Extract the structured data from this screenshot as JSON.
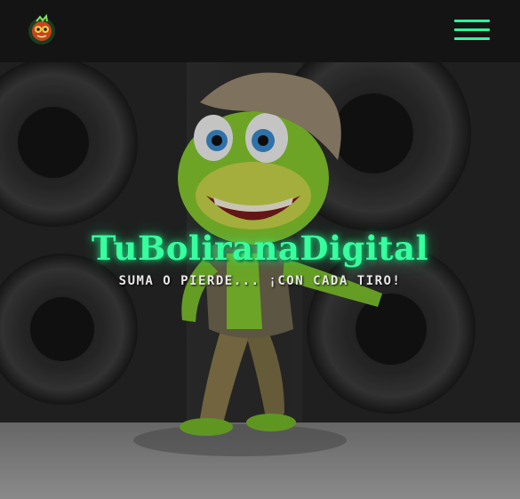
{
  "header": {
    "logo_icon": "frog-ball-logo-icon",
    "menu_icon": "hamburger-menu-icon",
    "accent_color": "#2dff9a"
  },
  "hero": {
    "title": "TuBoliranaDigital",
    "subtitle": "SUMA O PIERDE... ¡CON CADA TIRO!",
    "background_image": "cartoon-frog-speakers"
  }
}
